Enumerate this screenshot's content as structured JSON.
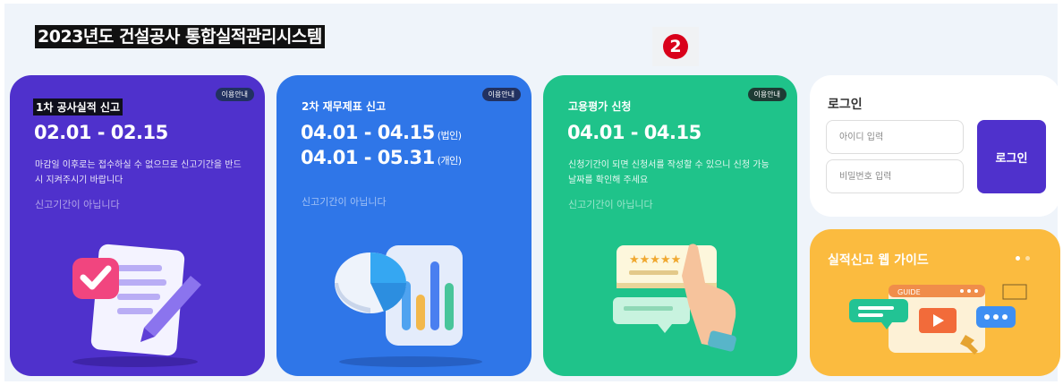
{
  "header": {
    "title": "2023년도 건설공사 통합실적관리시스템",
    "step_marker": "2"
  },
  "cards": [
    {
      "badge": "이용안내",
      "title": "1차 공사실적 신고",
      "periods": [
        {
          "range": "02.01 - 02.15",
          "note": ""
        }
      ],
      "description": "마감일 이후로는 접수하실 수 없으므로 신고기간을 반드시 지켜주시기 바랍니다",
      "status": "신고기간이 아닙니다",
      "color": "#4f31cc",
      "icon": "document-pencil-checkmark-icon"
    },
    {
      "badge": "이용안내",
      "title": "2차 재무제표 신고",
      "periods": [
        {
          "range": "04.01 - 04.15",
          "note": "(법인)"
        },
        {
          "range": "04.01 - 05.31",
          "note": "(개인)"
        }
      ],
      "description": "",
      "status": "신고기간이 아닙니다",
      "color": "#2f76e8",
      "icon": "pie-bar-chart-icon"
    },
    {
      "badge": "이용안내",
      "title": "고용평가 신청",
      "periods": [
        {
          "range": "04.01 - 04.15",
          "note": ""
        }
      ],
      "description": "신청기간이 되면 신청서를 작성할 수 있으니 신청 가능 날짜를 확인해 주세요",
      "status": "신고기간이 아닙니다",
      "color": "#1fc38a",
      "icon": "rating-review-hand-icon"
    }
  ],
  "login": {
    "title": "로그인",
    "id_placeholder": "아이디 입력",
    "pw_placeholder": "비밀번호 입력",
    "button_label": "로그인",
    "accent": "#4f31cc"
  },
  "guide": {
    "title": "실적신고 웹 가이드",
    "illustration_text": "GUIDE",
    "color": "#fbbb3f",
    "icon": "guide-window-video-icon"
  }
}
